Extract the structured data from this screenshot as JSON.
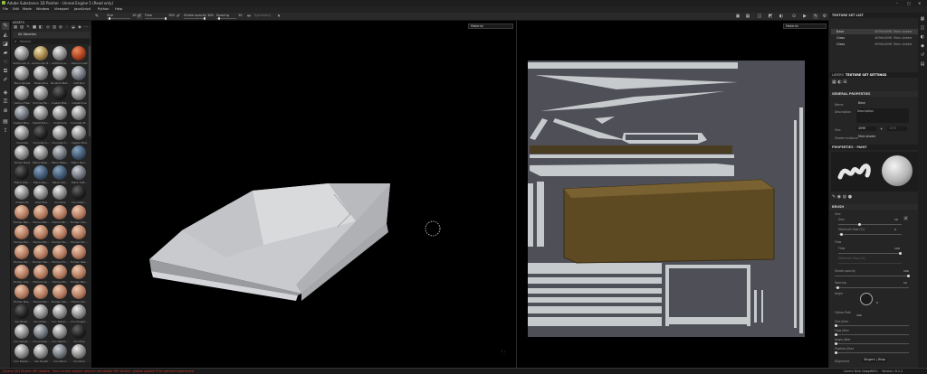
{
  "window": {
    "title": "Adobe Substance 3D Painter - Unreal Engine 5 (Read only)",
    "controls": [
      "–",
      "▢",
      "✕"
    ]
  },
  "menu": [
    "File",
    "Edit",
    "Mode",
    "Window",
    "Viewport",
    "JavaScript",
    "Python",
    "Help"
  ],
  "tool_options": {
    "size_label": "Size",
    "size_value": "10",
    "flow_label": "Flow",
    "flow_value": "100",
    "stroke_opacity_label": "Stroke opacity",
    "stroke_opacity_value": "100",
    "spacing_label": "Spacing",
    "spacing_value": "10",
    "symmetry_label": "Symmetry"
  },
  "assets": {
    "panel_title": "ASSETS",
    "library": "All libraries",
    "search_placeholder": "Search",
    "items": [
      "Aluminium A…",
      "Aluminium B…",
      "Artificial Le…",
      "Autumn Leaf",
      "Bone Simple",
      "Brass Pure",
      "Brushed Met…",
      "Calf Skin",
      "Carbon Fiber",
      "Chrome Fib…",
      "Coated Met…",
      "Cobalt Pure",
      "Coated Stre…",
      "Cobalt Burn…",
      "Cloth Pure",
      "Concrete M…",
      "Concrete",
      "Concrete S…",
      "Concrete S…",
      "Copper Pure",
      "Denim Rivet",
      "Fabric Base…",
      "Fabric Base…",
      "Fabric Den…",
      "Fabric Knit…",
      "Fabric Rou…",
      "Fabric Sim…",
      "Fabric Soft…",
      "Footprints",
      "Gold Pure",
      "Iron Pure",
      "Iron Grain…",
      "Human Bac…",
      "Human Bel…",
      "Human Bic…",
      "Human Che…",
      "Human Ear…",
      "Human Elb…",
      "Human Fac…",
      "Human Fac…",
      "Human Fac…",
      "Human Fee…",
      "Human For…",
      "Human Hea…",
      "Human Kne…",
      "Human Lip…",
      "Human Mo…",
      "Human Nec…",
      "Human Nos…",
      "Human Pal…",
      "Human Sho…",
      "Human Ski…",
      "Iron Brush…",
      "Iron Chain…",
      "Iron Diamo…",
      "Iron Forged…",
      "Iron Galvan…",
      "Iron Grinde…",
      "Iron Hamm…",
      "Iron Pure",
      "Iron Powde…",
      "Iron Rough",
      "Iron Shiny",
      "Iron Pure"
    ]
  },
  "viewport_3d": {
    "mode": "Material"
  },
  "viewport_2d": {
    "mode": "Material"
  },
  "texture_set_list": {
    "title": "TEXTURE SET LIST",
    "sets": [
      {
        "name": "Base",
        "resolution": "4096x4096",
        "shader": "Main shader"
      },
      {
        "name": "Glass",
        "resolution": "4096x4096",
        "shader": "Main shader"
      },
      {
        "name": "Glass",
        "resolution": "4096x4096",
        "shader": "Main shader"
      }
    ]
  },
  "settings_tabs": [
    "LAYERS",
    "TEXTURE SET SETTINGS"
  ],
  "general_properties": {
    "title": "GENERAL PROPERTIES",
    "name_label": "Name",
    "name_value": "Base",
    "description_label": "Description",
    "description_value": "Description",
    "size_label": "Size",
    "size_value": "4096",
    "size_value_2": "4096",
    "shader_label": "Shader Instance",
    "shader_value": "Main shader"
  },
  "properties_paint": {
    "title": "PROPERTIES - PAINT",
    "brush_section": "BRUSH",
    "size_group": "Size",
    "size_label": "Size",
    "size_value": "10",
    "min_size_label": "Minimum Size (%)",
    "min_size_value": "0",
    "flow_group": "Flow",
    "flow_label": "Flow",
    "flow_value": "100",
    "min_flow_label": "Minimum Flow (%)",
    "stroke_opacity_label": "Stroke opacity",
    "stroke_opacity_value": "100",
    "spacing_label": "Spacing",
    "spacing_value": "10",
    "angle_label": "Angle",
    "angle_value": "0",
    "follow_path_label": "Follow Path",
    "follow_path_value": "100",
    "size_jitter_label": "Size Jitter",
    "flow_jitter_label": "Flow Jitter",
    "angle_jitter_label": "Angle Jitter",
    "position_jitter_label": "Position Jitter",
    "alignment_label": "Alignment",
    "alignment_value": "Tangent | Wrap"
  },
  "status": {
    "message": "[Scene 3D] Shader API Update - Your current project uses an old shader API version; please update it for optimal experience.",
    "cache": "Cache Disk Usage:",
    "cache_value": "54%",
    "version": "Version: 8.1.2"
  },
  "colors": {
    "accent": "#8fc13e",
    "error": "#c63b31",
    "uv_island": "#c7cacd",
    "uv_border": "#4f5057",
    "uv_highlight": "#5e4a22"
  }
}
